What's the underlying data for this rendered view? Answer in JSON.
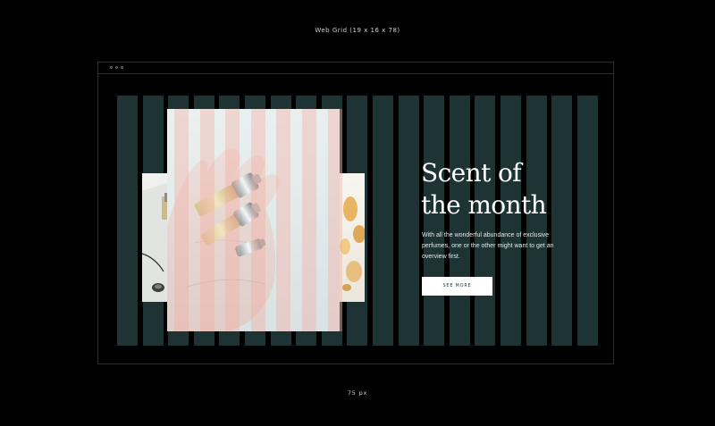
{
  "captions": {
    "top": "Web Grid (19 x 16 x 78)",
    "bottom": "75 px"
  },
  "browser": {
    "window_controls": [
      "dot",
      "dot",
      "dot"
    ]
  },
  "hero": {
    "headline_line1": "Scent of",
    "headline_line2": "the month",
    "body": "With all the wonderful abundance of exclusive perfumes, one or the other might want to get an overview first.",
    "cta_label": "SEE MORE"
  },
  "colors": {
    "background": "#000000",
    "grid_column": "#1e3434",
    "overlay_column": "#f4aca0",
    "cta_background": "#ffffff",
    "cta_text": "#1e3434"
  },
  "images": {
    "main": "hand-holding-perfume-vials-photo",
    "left": "perfume-bottle-cropped-photo",
    "right": "amber-perfume-cropped-photo"
  }
}
